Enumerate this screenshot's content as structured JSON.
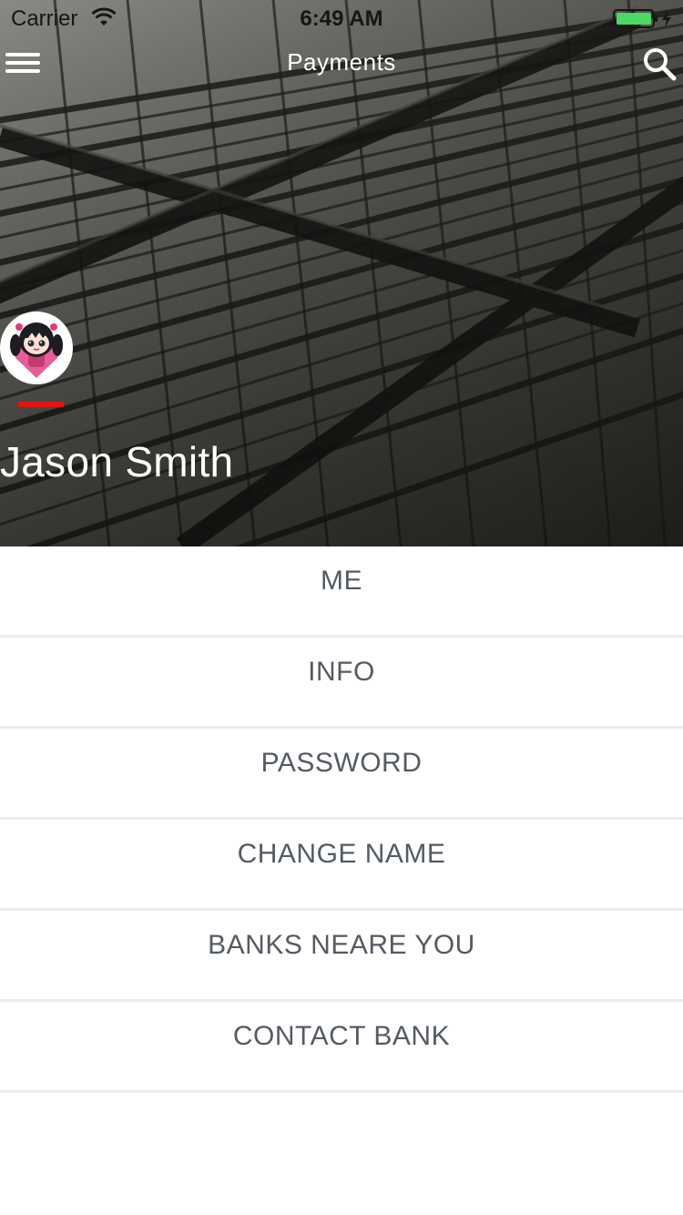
{
  "status_bar": {
    "carrier": "Carrier",
    "time": "6:49 AM",
    "battery_color": "#4cd964"
  },
  "nav": {
    "title": "Payments",
    "menu_icon": "hamburger-menu-icon",
    "search_icon": "search-icon"
  },
  "profile": {
    "name": "Jason Smith",
    "accent_color": "#e11414"
  },
  "menu": {
    "items": [
      {
        "label": "ME"
      },
      {
        "label": "INFO"
      },
      {
        "label": "PASSWORD"
      },
      {
        "label": "CHANGE NAME"
      },
      {
        "label": "BANKS NEARE YOU"
      },
      {
        "label": "CONTACT BANK"
      }
    ]
  }
}
